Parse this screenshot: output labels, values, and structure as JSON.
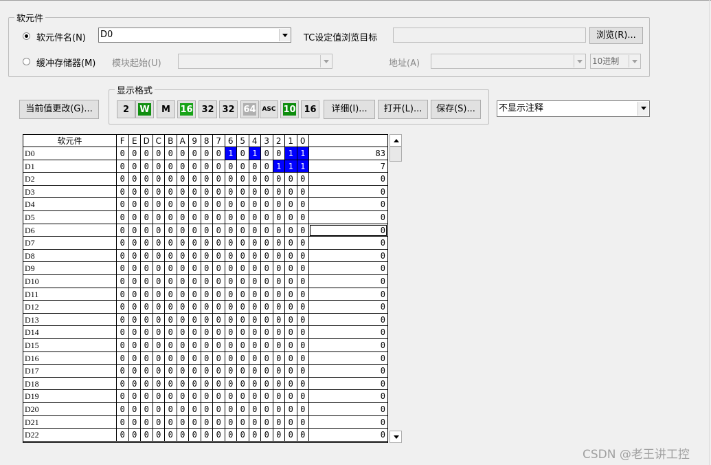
{
  "device_group": {
    "legend": "软元件",
    "device_name_radio": "软元件名(N)",
    "device_name_value": "D0",
    "tc_label": "TC设定值浏览目标",
    "tc_value": "",
    "browse_button": "浏览(R)...",
    "buffer_radio": "缓冲存储器(M)",
    "module_start_label": "模块起始(U)",
    "address_label": "地址(A)",
    "radix_value": "10进制"
  },
  "toolbar": {
    "change_value_button": "当前值更改(G)...",
    "format_legend": "显示格式",
    "icons": [
      {
        "name": "bit-format-icon",
        "text": "2",
        "bg": "#e1e1e1",
        "fg": "#000"
      },
      {
        "name": "word-format-icon",
        "text": "W",
        "bg": "#118f11",
        "fg": "#fff"
      },
      {
        "name": "double-word-format-icon",
        "text": "M",
        "bg": "#e1e1e1",
        "fg": "#000"
      },
      {
        "name": "16bit-format-icon",
        "text": "16",
        "bg": "#17a317",
        "fg": "#fff"
      },
      {
        "name": "32bit-format-icon",
        "text": "32",
        "bg": "#e1e1e1",
        "fg": "#000"
      },
      {
        "name": "32bit-float-format-icon",
        "text": "32",
        "bg": "#e1e1e1",
        "fg": "#000"
      },
      {
        "name": "64bit-format-icon",
        "text": "64",
        "bg": "#b0b0b0",
        "fg": "#fff"
      },
      {
        "name": "ascii-format-icon",
        "text": "ASC",
        "bg": "#e1e1e1",
        "fg": "#000"
      },
      {
        "name": "decimal-format-icon",
        "text": "10",
        "bg": "#0c8c0c",
        "fg": "#fff"
      },
      {
        "name": "hex-format-icon",
        "text": "16",
        "bg": "#e1e1e1",
        "fg": "#000"
      }
    ],
    "detail_button": "详细(I)...",
    "open_button": "打开(L)...",
    "save_button": "保存(S)...",
    "comment_select": "不显示注释"
  },
  "grid": {
    "device_header": "软元件",
    "bit_headers": [
      "F",
      "E",
      "D",
      "C",
      "B",
      "A",
      "9",
      "8",
      "7",
      "6",
      "5",
      "4",
      "3",
      "2",
      "1",
      "0"
    ],
    "rows": [
      {
        "device": "D0",
        "bits": "0000000001010011",
        "value": "83"
      },
      {
        "device": "D1",
        "bits": "0000000000000111",
        "value": "7"
      },
      {
        "device": "D2",
        "bits": "0000000000000000",
        "value": "0"
      },
      {
        "device": "D3",
        "bits": "0000000000000000",
        "value": "0"
      },
      {
        "device": "D4",
        "bits": "0000000000000000",
        "value": "0"
      },
      {
        "device": "D5",
        "bits": "0000000000000000",
        "value": "0"
      },
      {
        "device": "D6",
        "bits": "0000000000000000",
        "value": "0"
      },
      {
        "device": "D7",
        "bits": "0000000000000000",
        "value": "0"
      },
      {
        "device": "D8",
        "bits": "0000000000000000",
        "value": "0"
      },
      {
        "device": "D9",
        "bits": "0000000000000000",
        "value": "0"
      },
      {
        "device": "D10",
        "bits": "0000000000000000",
        "value": "0"
      },
      {
        "device": "D11",
        "bits": "0000000000000000",
        "value": "0"
      },
      {
        "device": "D12",
        "bits": "0000000000000000",
        "value": "0"
      },
      {
        "device": "D13",
        "bits": "0000000000000000",
        "value": "0"
      },
      {
        "device": "D14",
        "bits": "0000000000000000",
        "value": "0"
      },
      {
        "device": "D15",
        "bits": "0000000000000000",
        "value": "0"
      },
      {
        "device": "D16",
        "bits": "0000000000000000",
        "value": "0"
      },
      {
        "device": "D17",
        "bits": "0000000000000000",
        "value": "0"
      },
      {
        "device": "D18",
        "bits": "0000000000000000",
        "value": "0"
      },
      {
        "device": "D19",
        "bits": "0000000000000000",
        "value": "0"
      },
      {
        "device": "D20",
        "bits": "0000000000000000",
        "value": "0"
      },
      {
        "device": "D21",
        "bits": "0000000000000000",
        "value": "0"
      },
      {
        "device": "D22",
        "bits": "0000000000000000",
        "value": "0"
      }
    ],
    "selected_row": "D6",
    "on_color": "#0000ff"
  },
  "watermark": "CSDN @老王讲工控"
}
